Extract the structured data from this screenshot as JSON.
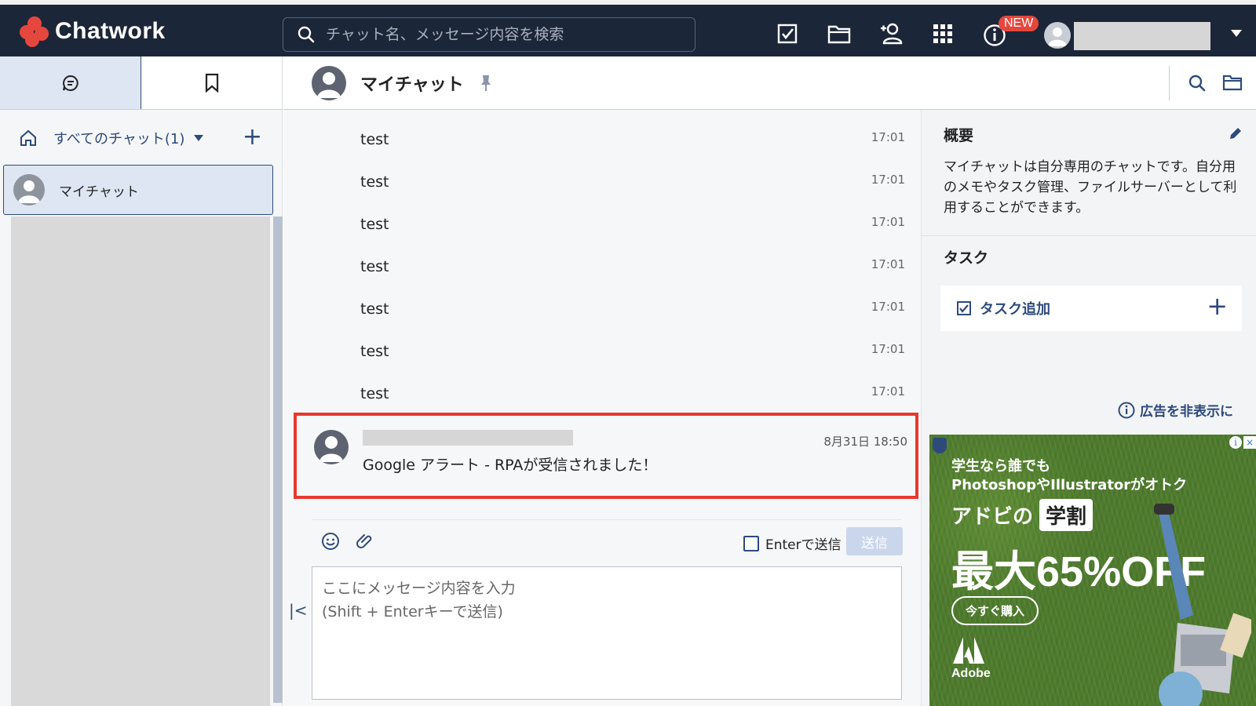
{
  "app": {
    "name": "Chatwork"
  },
  "header": {
    "search_placeholder": "チャット名、メッセージ内容を検索",
    "new_badge": "NEW",
    "icons": [
      "task-icon",
      "folder-icon",
      "contact-icon",
      "apps-grid-icon",
      "info-icon"
    ]
  },
  "sidebar": {
    "filter_label": "すべてのチャット(1)",
    "rooms": [
      {
        "name": "マイチャット"
      }
    ]
  },
  "room": {
    "title": "マイチャット"
  },
  "messages": [
    {
      "body": "test",
      "time": "17:01"
    },
    {
      "body": "test",
      "time": "17:01"
    },
    {
      "body": "test",
      "time": "17:01"
    },
    {
      "body": "test",
      "time": "17:01"
    },
    {
      "body": "test",
      "time": "17:01"
    },
    {
      "body": "test",
      "time": "17:01"
    },
    {
      "body": "test",
      "time": "17:01"
    }
  ],
  "highlighted_message": {
    "time": "8月31日 18:50",
    "body": "Google アラート - RPAが受信されました！"
  },
  "composer": {
    "enter_label": "Enterで送信",
    "send_label": "送信",
    "placeholder": "ここにメッセージ内容を入力\n(Shift + Enterキーで送信)"
  },
  "right_panel": {
    "overview_title": "概要",
    "overview_text": "マイチャットは自分専用のチャットです。自分用のメモやタスク管理、ファイルサーバーとして利用することができます。",
    "task_title": "タスク",
    "task_add_label": "タスク追加",
    "hide_ads_label": "広告を非表示に"
  },
  "ad": {
    "line1": "学生なら誰でも",
    "line2": "PhotoshopやIllustratorがオトク",
    "line3": "アドビの",
    "gakuwari": "学割",
    "line4": "最大65%OFF",
    "cta": "今すぐ購入",
    "brand": "Adobe"
  },
  "colors": {
    "header_bg": "#1c2639",
    "accent": "#2d4a7a",
    "brand_red": "#e6473d",
    "highlight_border": "#e8382e"
  }
}
